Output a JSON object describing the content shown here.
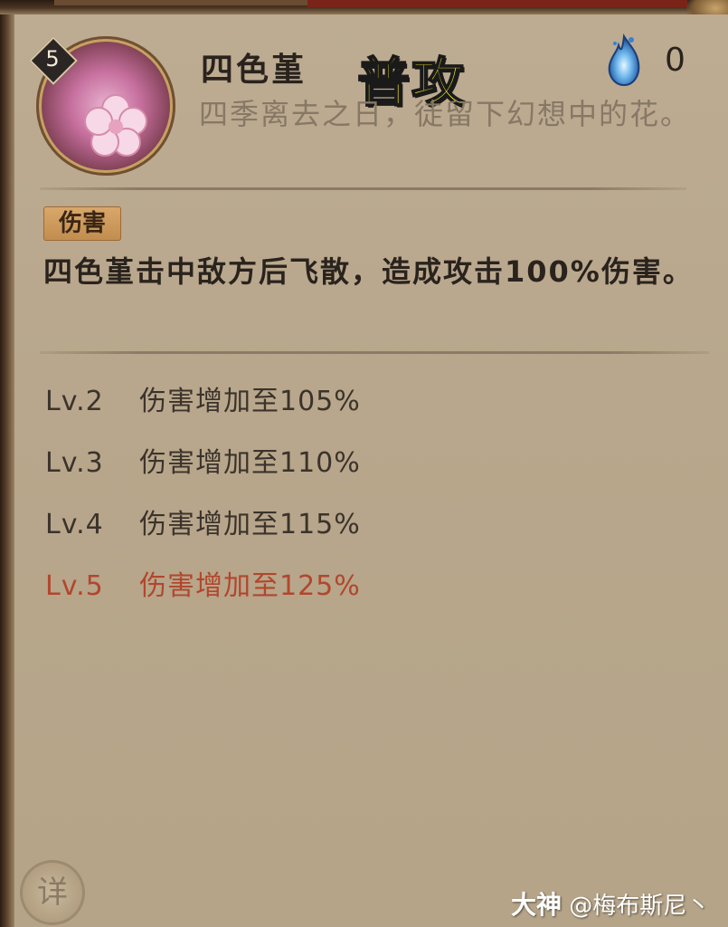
{
  "skill": {
    "level": "5",
    "name": "四色堇",
    "type_label": "普攻",
    "orb_cost": "0",
    "flavor": "四季离去之日，徒留下幻想中的花。"
  },
  "effect": {
    "tag": "伤害",
    "description": "四色堇击中敌方后飞散，造成攻击100%伤害。"
  },
  "levels": [
    {
      "lv": "Lv.2",
      "text": "伤害增加至105%"
    },
    {
      "lv": "Lv.3",
      "text": "伤害增加至110%"
    },
    {
      "lv": "Lv.4",
      "text": "伤害增加至115%"
    },
    {
      "lv": "Lv.5",
      "text": "伤害增加至125%"
    }
  ],
  "detail_button": {
    "label": "详"
  },
  "watermark": {
    "brand": "大神",
    "handle": "@梅布斯尼丶"
  },
  "colors": {
    "panel": "#b9a88d",
    "type_label": "#f7f21c",
    "active_level": "#b2462d",
    "tag": "#c9965a"
  },
  "icons": [
    "skill-flower-icon",
    "level-badge-icon",
    "soul-orb-icon",
    "detail-icon"
  ]
}
